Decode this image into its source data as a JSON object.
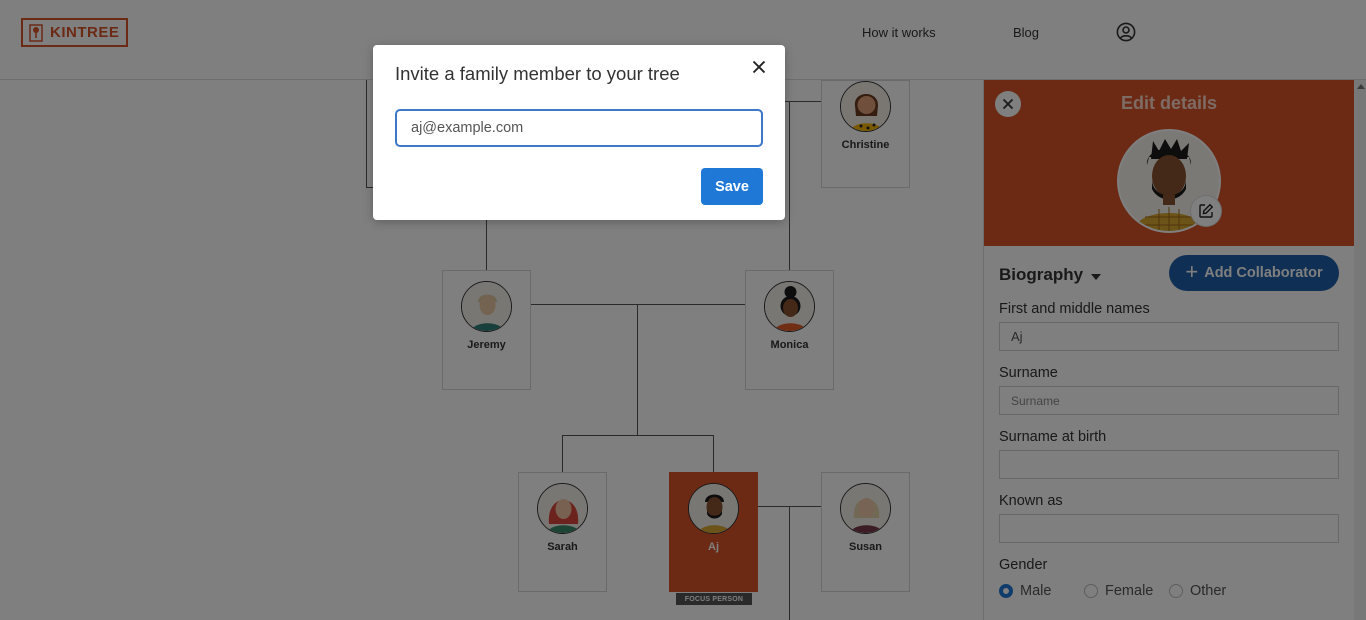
{
  "header": {
    "logo_text": "KINTREE",
    "nav": [
      {
        "label": "How it works"
      },
      {
        "label": "Blog"
      }
    ],
    "account_icon": "user-circle-icon"
  },
  "tree": {
    "people": [
      {
        "name": "Christine",
        "icon": "avatar-woman-icon"
      },
      {
        "name": "Jeremy",
        "icon": "avatar-man-icon"
      },
      {
        "name": "Monica",
        "icon": "avatar-woman-icon"
      },
      {
        "name": "Sarah",
        "icon": "avatar-woman-icon"
      },
      {
        "name": "Aj",
        "icon": "avatar-man-icon",
        "focus": true
      },
      {
        "name": "Susan",
        "icon": "avatar-woman-icon"
      }
    ],
    "focus_label": "FOCUS PERSON",
    "colors": {
      "focus": "#d8552b"
    }
  },
  "panel": {
    "title": "Edit details",
    "section": "Biography",
    "add_collaborator": "Add Collaborator",
    "fields": [
      {
        "label": "First and middle names",
        "value": "Aj",
        "placeholder": ""
      },
      {
        "label": "Surname",
        "value": "",
        "placeholder": "Surname"
      },
      {
        "label": "Surname at birth",
        "value": "",
        "placeholder": ""
      },
      {
        "label": "Known as",
        "value": "",
        "placeholder": ""
      }
    ],
    "gender": {
      "label": "Gender",
      "options": [
        "Male",
        "Female",
        "Other"
      ],
      "selected": "Male"
    },
    "colors": {
      "header": "#d8552b",
      "button": "#1e5fa8"
    }
  },
  "modal": {
    "title": "Invite a family member to your tree",
    "email_value": "aj@example.com",
    "save_label": "Save",
    "colors": {
      "save": "#1f78d6"
    }
  }
}
